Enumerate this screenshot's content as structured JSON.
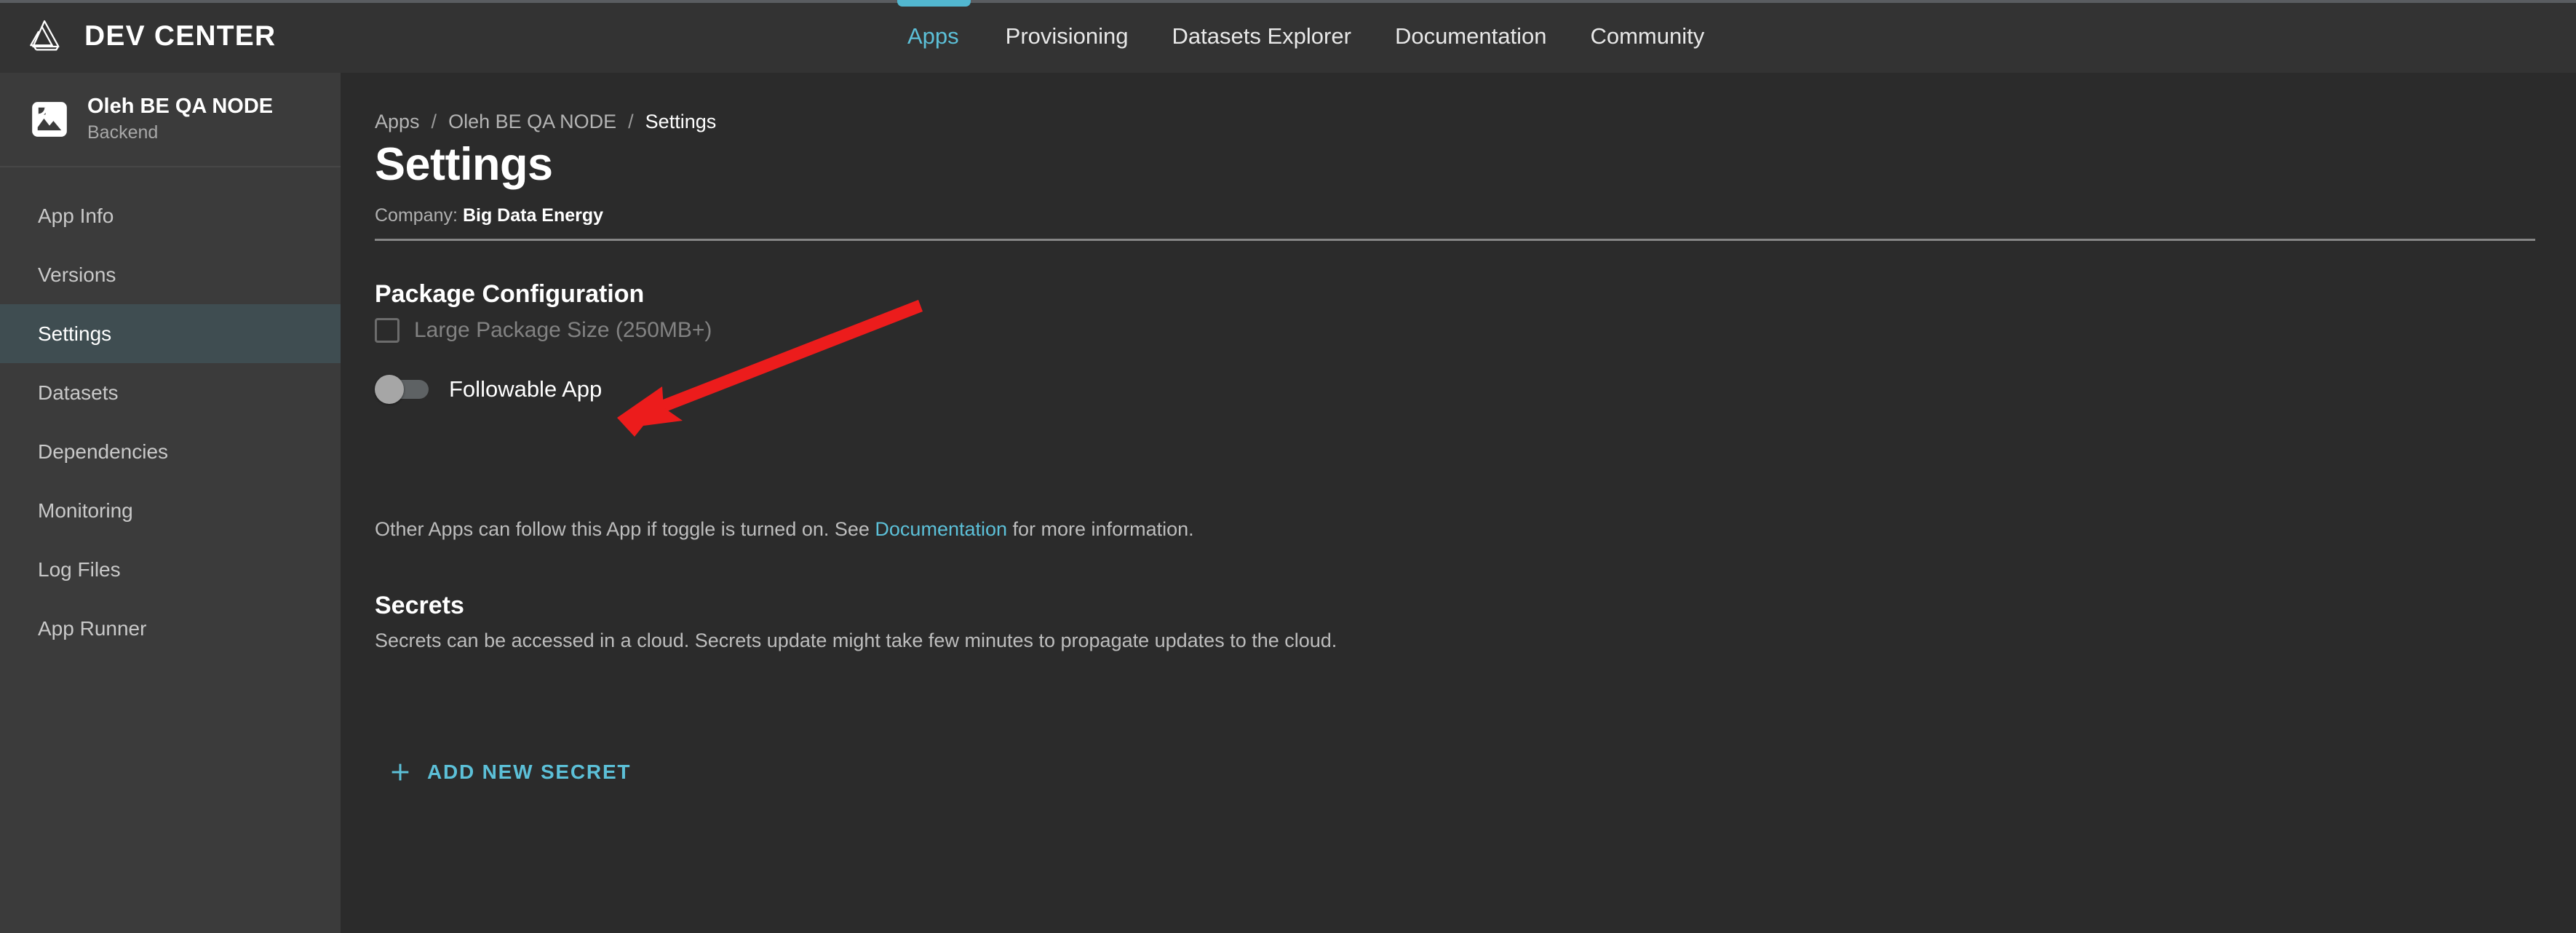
{
  "header": {
    "brand_name": "DEV CENTER",
    "logo_icon": "mobius-triangle-logo",
    "nav": [
      {
        "label": "Apps",
        "active": true
      },
      {
        "label": "Provisioning",
        "active": false
      },
      {
        "label": "Datasets Explorer",
        "active": false
      },
      {
        "label": "Documentation",
        "active": false
      },
      {
        "label": "Community",
        "active": false
      }
    ]
  },
  "sidebar": {
    "app_icon": "broken-image-icon",
    "app_name": "Oleh BE QA NODE",
    "app_type": "Backend",
    "items": [
      {
        "label": "App Info",
        "active": false
      },
      {
        "label": "Versions",
        "active": false
      },
      {
        "label": "Settings",
        "active": true
      },
      {
        "label": "Datasets",
        "active": false
      },
      {
        "label": "Dependencies",
        "active": false
      },
      {
        "label": "Monitoring",
        "active": false
      },
      {
        "label": "Log Files",
        "active": false
      },
      {
        "label": "App Runner",
        "active": false
      }
    ]
  },
  "main": {
    "breadcrumb": [
      {
        "label": "Apps",
        "current": false
      },
      {
        "label": "Oleh BE QA NODE",
        "current": false
      },
      {
        "label": "Settings",
        "current": true
      }
    ],
    "breadcrumb_separator": "/",
    "page_title": "Settings",
    "company_label": "Company:",
    "company_value": "Big Data Energy",
    "package_configuration": {
      "heading": "Package Configuration",
      "large_package_checkbox": {
        "label": "Large Package Size (250MB+)",
        "checked": false,
        "disabled": true
      },
      "followable_toggle": {
        "label": "Followable App",
        "state": "off"
      },
      "description_before_link": "Other Apps can follow this App if toggle is turned on. See ",
      "description_link": "Documentation",
      "description_after_link": " for more information."
    },
    "secrets": {
      "heading": "Secrets",
      "description": "Secrets can be accessed in a cloud. Secrets update might take few minutes to propagate updates to the cloud.",
      "add_button_label": "ADD NEW SECRET",
      "add_button_icon": "plus-icon"
    }
  },
  "annotation": {
    "type": "red-arrow",
    "points_to": "Followable App",
    "color": "#ec1c1c"
  },
  "colors": {
    "accent": "#5cc0d8",
    "topbar_bg": "#333333",
    "sidebar_bg": "#3b3b3b",
    "sidebar_active_bg": "#3f4d51",
    "content_bg": "#2b2b2b",
    "annotation_red": "#ec1c1c",
    "divider": "#868686"
  }
}
